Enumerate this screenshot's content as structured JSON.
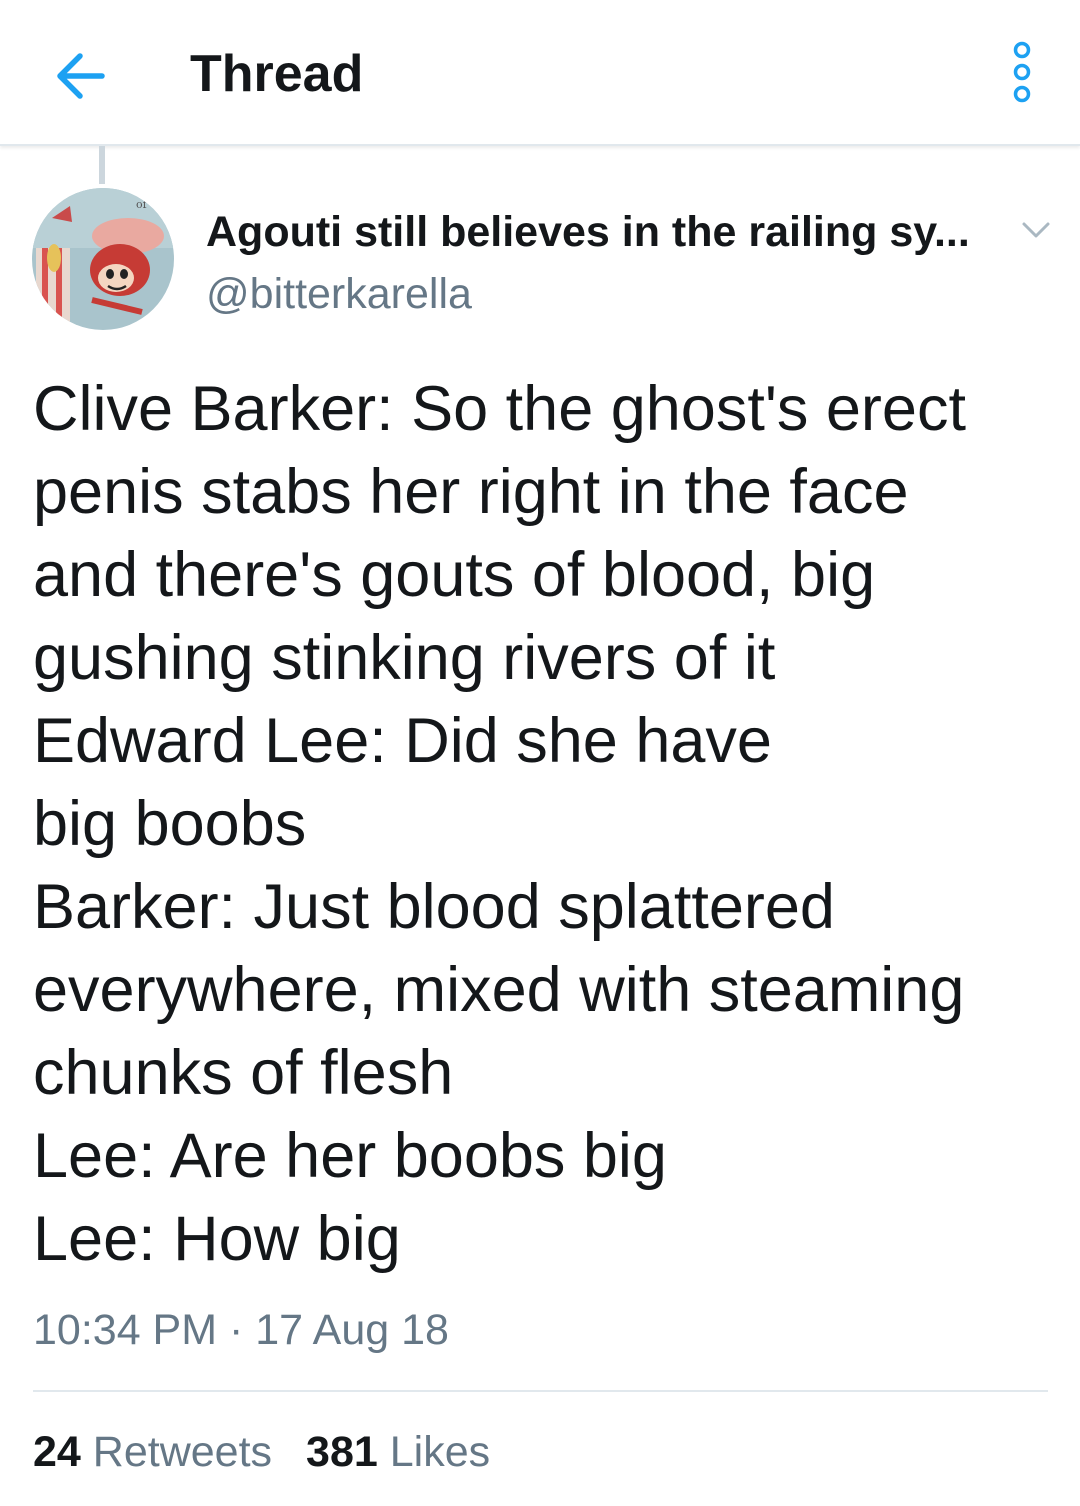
{
  "header": {
    "title": "Thread",
    "accent_color": "#1da1f2",
    "back_icon": "arrow-left-icon",
    "overflow_icon": "vertical-dots-icon"
  },
  "tweet": {
    "avatar_icon": "cartoon-avatar",
    "display_name": "Agouti still believes in the railing sy...",
    "handle": "@bitterkarella",
    "caret_icon": "chevron-down-icon",
    "text_lines": [
      "Clive Barker: So the ghost's erect",
      "penis stabs her right in the face",
      "and there's gouts of blood, big",
      "gushing stinking rivers of it",
      "Edward Lee: Did she have",
      "big boobs",
      "Barker: Just blood splattered",
      "everywhere, mixed with steaming",
      "chunks of flesh",
      "Lee: Are her boobs big",
      "Lee: How big"
    ],
    "timestamp": "10:34 PM · 17 Aug 18",
    "retweets_count": "24",
    "retweets_label": "Retweets",
    "likes_count": "381",
    "likes_label": "Likes"
  }
}
